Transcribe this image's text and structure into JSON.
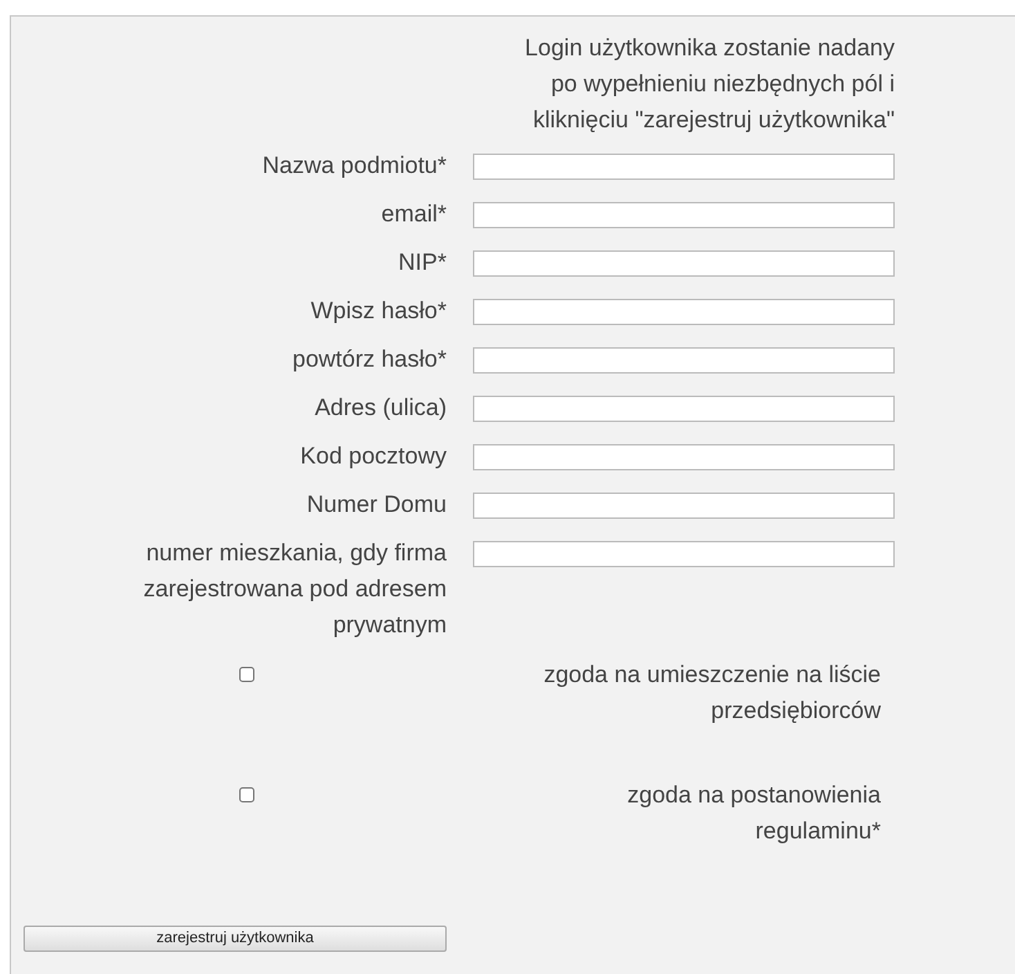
{
  "intro": "Login użytkownika zostanie nadany po wypełnieniu niezbędnych pól i kliknięciu \"zarejestruj użytkownika\"",
  "fields": [
    {
      "label": "Nazwa podmiotu*"
    },
    {
      "label": "email*"
    },
    {
      "label": "NIP*"
    },
    {
      "label": "Wpisz hasło*"
    },
    {
      "label": "powtórz hasło*"
    },
    {
      "label": "Adres (ulica)"
    },
    {
      "label": "Kod pocztowy"
    },
    {
      "label": "Numer Domu"
    },
    {
      "label": "numer mieszkania, gdy firma zarejestrowana pod adresem prywatnym"
    }
  ],
  "consents": [
    {
      "label": "zgoda na umieszczenie na liście przedsiębiorców",
      "checked": false
    },
    {
      "label": "zgoda na postanowienia regulaminu*",
      "checked": false
    }
  ],
  "submit": "zarejestruj użytkownika"
}
